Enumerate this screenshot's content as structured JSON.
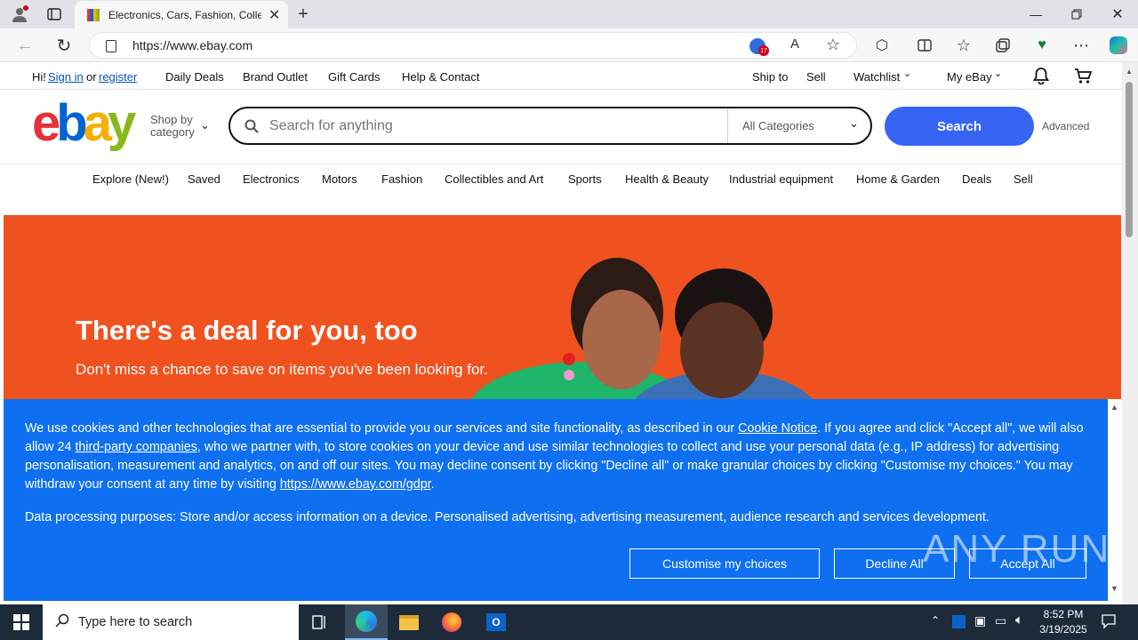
{
  "browser": {
    "tab_title": "Electronics, Cars, Fashion, Collect",
    "url": "https://www.ebay.com",
    "cookie_count_badge": "17"
  },
  "topnav": {
    "greeting": "Hi!",
    "sign_in": "Sign in",
    "or": "or",
    "register": "register",
    "daily_deals": "Daily Deals",
    "brand_outlet": "Brand Outlet",
    "gift_cards": "Gift Cards",
    "help_contact": "Help & Contact",
    "ship_to": "Ship to",
    "sell": "Sell",
    "watchlist": "Watchlist",
    "my_ebay": "My eBay"
  },
  "header": {
    "shop_by": "Shop by",
    "category": "category",
    "search_placeholder": "Search for anything",
    "category_select": "All Categories",
    "search_button": "Search",
    "advanced": "Advanced"
  },
  "categories": [
    "Explore (New!)",
    "Saved",
    "Electronics",
    "Motors",
    "Fashion",
    "Collectibles and Art",
    "Sports",
    "Health & Beauty",
    "Industrial equipment",
    "Home & Garden",
    "Deals",
    "Sell"
  ],
  "hero": {
    "title": "There's a deal for you, too",
    "subtitle": "Don't miss a chance to save on items you've been looking for."
  },
  "cookie": {
    "p1_a": "We use cookies and other technologies that are essential to provide you our services and site functionality, as described in our ",
    "cookie_notice": "Cookie Notice",
    "p1_b": ". If you agree and click \"Accept all\", we will also allow 24 ",
    "third_party": "third-party companies",
    "p1_c": ", who we partner with, to store cookies on your device and use similar technologies to collect and use your personal data (e.g., IP address) for advertising personalisation, measurement and analytics, on and off our sites. You may decline consent by clicking \"Decline all\" or make granular choices by clicking \"Customise my choices.\" You may withdraw your consent at any time by visiting ",
    "gdpr_link": "https://www.ebay.com/gdpr",
    "p1_d": ".",
    "p2": "Data processing purposes: Store and/or access information on a device. Personalised advertising, advertising measurement, audience research and services development.",
    "customise": "Customise my choices",
    "decline": "Decline All",
    "accept": "Accept All"
  },
  "watermark": "ANY RUN",
  "taskbar": {
    "search_placeholder": "Type here to search",
    "time": "8:52 PM",
    "date": "3/19/2025"
  },
  "colors": {
    "ebay_blue": "#3665f3",
    "cookie_bg": "#0e70f0",
    "hero_bg": "#f0521f"
  }
}
